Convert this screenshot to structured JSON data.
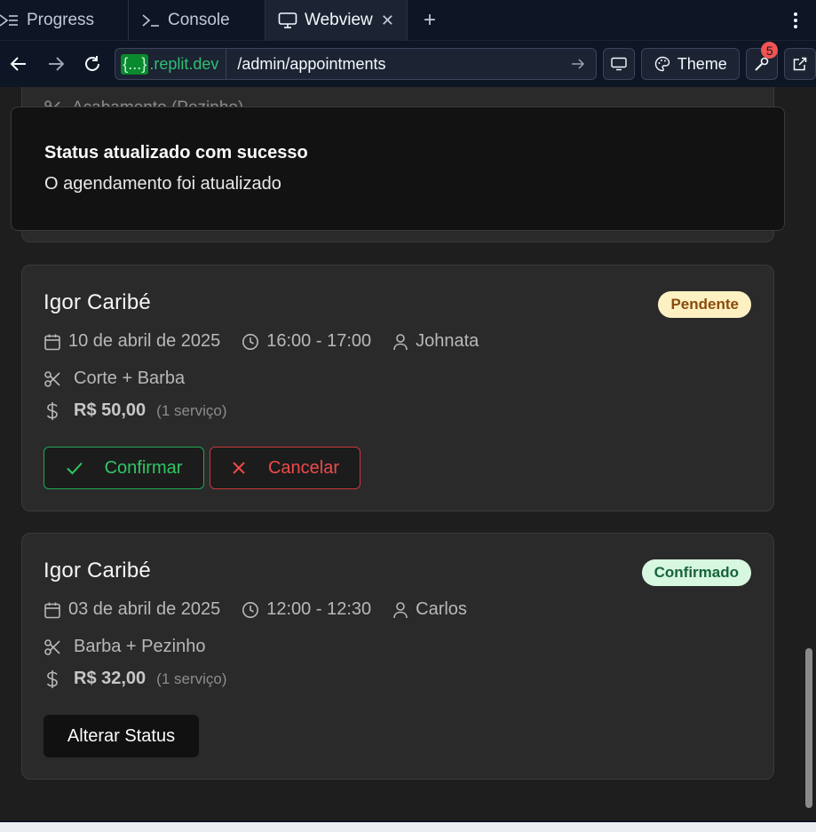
{
  "tabs": [
    {
      "label": "Progress",
      "icon": "progress-icon"
    },
    {
      "label": "Console",
      "icon": "terminal-icon"
    },
    {
      "label": "Webview",
      "icon": "monitor-icon",
      "active": true
    }
  ],
  "address": {
    "host_brace": "{...}",
    "host": ".replit.dev",
    "path": "/admin/appointments",
    "theme_label": "Theme",
    "devtools_badge": "5"
  },
  "toast": {
    "title": "Status atualizado com sucesso",
    "description": "O agendamento foi atualizado"
  },
  "ghost": {
    "text": "Acabamento (Pezinho)"
  },
  "appointments": [
    {
      "client": "Igor Caribé",
      "status": "Pendente",
      "date": "10 de abril de 2025",
      "time": "16:00 - 17:00",
      "barber": "Johnata",
      "services": "Corte + Barba",
      "price": "R$ 50,00",
      "service_count": "(1 serviço)",
      "actions": {
        "confirm": "Confirmar",
        "cancel": "Cancelar"
      }
    },
    {
      "client": "Igor Caribé",
      "status": "Confirmado",
      "date": "03 de abril de 2025",
      "time": "12:00 - 12:30",
      "barber": "Carlos",
      "services": "Barba + Pezinho",
      "price": "R$ 32,00",
      "service_count": "(1 serviço)",
      "actions": {
        "alter": "Alterar Status"
      }
    }
  ],
  "colors": {
    "pending_bg": "#fdf1c4",
    "confirmed_bg": "#d7f7e0",
    "confirm_green": "#2ec765",
    "cancel_red": "#ef4a4a"
  }
}
